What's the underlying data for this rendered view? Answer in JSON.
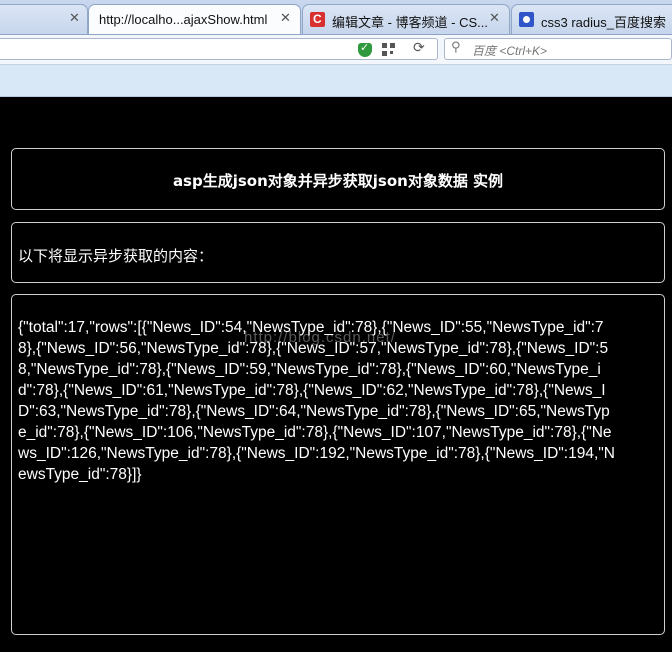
{
  "browser": {
    "tabs": [
      {
        "title": "",
        "active": false
      },
      {
        "title": "http://localho...ajaxShow.html",
        "active": true
      },
      {
        "title": "编辑文章 - 博客频道 - CS...",
        "active": false,
        "icon": "csdn-icon"
      },
      {
        "title": "css3 radius_百度搜索",
        "active": false,
        "icon": "baidu-icon"
      }
    ],
    "close_glyph": "✕",
    "search_placeholder": "百度 <Ctrl+K>"
  },
  "page": {
    "heading": "asp生成json对象并异步获取json对象数据 实例",
    "intro": "以下将显示异步获取的内容：",
    "json_text": "{\"total\":17,\"rows\":[{\"News_ID\":54,\"NewsType_id\":78},{\"News_ID\":55,\"NewsType_id\":78},{\"News_ID\":56,\"NewsType_id\":78},{\"News_ID\":57,\"NewsType_id\":78},{\"News_ID\":58,\"NewsType_id\":78},{\"News_ID\":59,\"NewsType_id\":78},{\"News_ID\":60,\"NewsType_id\":78},{\"News_ID\":61,\"NewsType_id\":78},{\"News_ID\":62,\"NewsType_id\":78},{\"News_ID\":63,\"NewsType_id\":78},{\"News_ID\":64,\"NewsType_id\":78},{\"News_ID\":65,\"NewsType_id\":78},{\"News_ID\":106,\"NewsType_id\":78},{\"News_ID\":107,\"NewsType_id\":78},{\"News_ID\":126,\"NewsType_id\":78},{\"News_ID\":192,\"NewsType_id\":78},{\"News_ID\":194,\"NewsType_id\":78}]}",
    "watermark": "http://blog.csdn.net/"
  }
}
